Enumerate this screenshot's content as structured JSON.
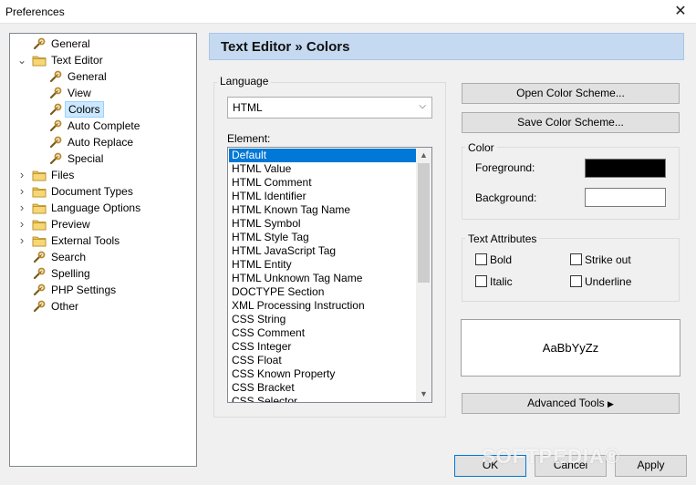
{
  "window": {
    "title": "Preferences",
    "close_glyph": "✕"
  },
  "tree": {
    "items": [
      {
        "label": "General",
        "level": 1,
        "type": "page"
      },
      {
        "label": "Text Editor",
        "level": 1,
        "type": "folder",
        "expanded": true
      },
      {
        "label": "General",
        "level": 2,
        "type": "page"
      },
      {
        "label": "View",
        "level": 2,
        "type": "page"
      },
      {
        "label": "Colors",
        "level": 2,
        "type": "page",
        "selected": true
      },
      {
        "label": "Auto Complete",
        "level": 2,
        "type": "page"
      },
      {
        "label": "Auto Replace",
        "level": 2,
        "type": "page"
      },
      {
        "label": "Special",
        "level": 2,
        "type": "page"
      },
      {
        "label": "Files",
        "level": 1,
        "type": "folder",
        "expanded": false
      },
      {
        "label": "Document Types",
        "level": 1,
        "type": "folder",
        "expanded": false
      },
      {
        "label": "Language Options",
        "level": 1,
        "type": "folder",
        "expanded": false
      },
      {
        "label": "Preview",
        "level": 1,
        "type": "folder",
        "expanded": false
      },
      {
        "label": "External Tools",
        "level": 1,
        "type": "folder",
        "expanded": false
      },
      {
        "label": "Search",
        "level": 1,
        "type": "page"
      },
      {
        "label": "Spelling",
        "level": 1,
        "type": "page"
      },
      {
        "label": "PHP Settings",
        "level": 1,
        "type": "page"
      },
      {
        "label": "Other",
        "level": 1,
        "type": "page"
      }
    ]
  },
  "header": {
    "title": "Text Editor » Colors"
  },
  "language": {
    "group_label": "Language",
    "selected": "HTML",
    "element_label": "Element:",
    "elements": [
      "Default",
      "HTML Value",
      "HTML Comment",
      "HTML Identifier",
      "HTML Known Tag Name",
      "HTML Symbol",
      "HTML Style Tag",
      "HTML JavaScript Tag",
      "HTML Entity",
      "HTML Unknown Tag Name",
      "DOCTYPE Section",
      "XML Processing Instruction",
      "CSS String",
      "CSS Comment",
      "CSS Integer",
      "CSS Float",
      "CSS Known Property",
      "CSS Bracket",
      "CSS Selector"
    ],
    "selected_element": "Default"
  },
  "scheme": {
    "open_label": "Open Color Scheme...",
    "save_label": "Save Color Scheme..."
  },
  "color": {
    "group_label": "Color",
    "foreground_label": "Foreground:",
    "background_label": "Background:",
    "foreground_value": "#000000",
    "background_value": "#ffffff"
  },
  "attributes": {
    "group_label": "Text Attributes",
    "bold": "Bold",
    "strikeout": "Strike out",
    "italic": "Italic",
    "underline": "Underline"
  },
  "preview": {
    "sample": "AaBbYyZz"
  },
  "advanced": {
    "label": "Advanced Tools",
    "glyph": "▶"
  },
  "footer": {
    "ok": "OK",
    "cancel": "Cancel",
    "apply": "Apply"
  },
  "watermark": "SOFTPEDIA®"
}
